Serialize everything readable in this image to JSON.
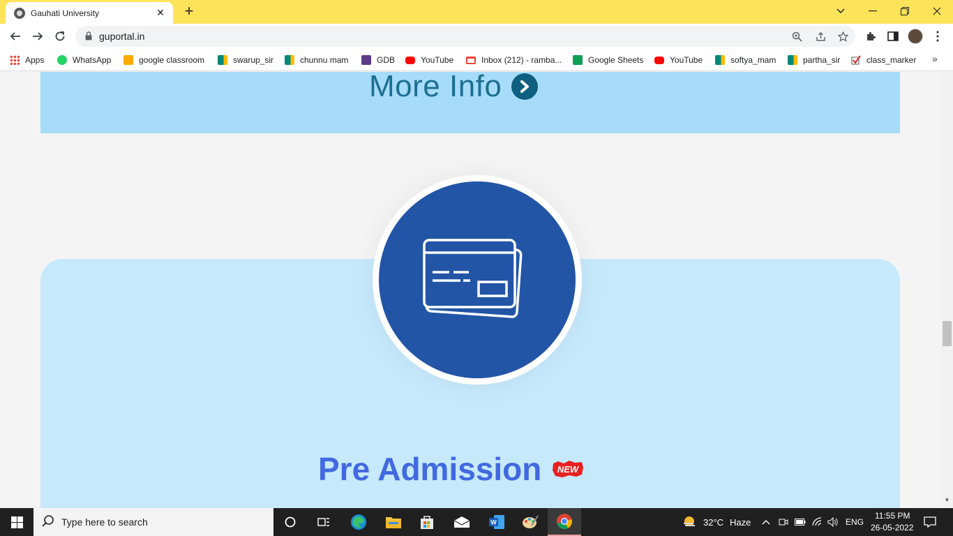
{
  "browser": {
    "tab_title": "Gauhati University",
    "tab_close": "✕",
    "new_tab": "+",
    "url": "guportal.in",
    "window_controls": {
      "minimize": "—",
      "maximize": "❐",
      "close": "✕",
      "tab_search": "⌄"
    }
  },
  "bookmarks": [
    {
      "label": "Apps",
      "icon": "apps-grid-icon"
    },
    {
      "label": "WhatsApp",
      "icon": "whatsapp-icon",
      "color": "#25d366"
    },
    {
      "label": "google classroom",
      "icon": "classroom-icon",
      "color": "#f9ab00"
    },
    {
      "label": "swarup_sir",
      "icon": "meet-icon",
      "color": "#00897b"
    },
    {
      "label": "chunnu mam",
      "icon": "meet-icon",
      "color": "#00897b"
    },
    {
      "label": "GDB",
      "icon": "gdb-icon",
      "color": "#5b3c88"
    },
    {
      "label": "YouTube",
      "icon": "youtube-icon",
      "color": "#ff0000"
    },
    {
      "label": "Inbox (212) - ramba...",
      "icon": "gmail-icon",
      "color": "#ea4335"
    },
    {
      "label": "Google Sheets",
      "icon": "sheets-icon",
      "color": "#0f9d58"
    },
    {
      "label": "YouTube",
      "icon": "youtube-icon",
      "color": "#ff0000"
    },
    {
      "label": "softya_mam",
      "icon": "meet-icon",
      "color": "#00897b"
    },
    {
      "label": "partha_sir",
      "icon": "meet-icon",
      "color": "#00897b"
    },
    {
      "label": "class_marker",
      "icon": "checkmark-icon",
      "color": "#d93025"
    }
  ],
  "bookmarks_more": "»",
  "page": {
    "more_info": "More Info",
    "card_title": "Pre Admission",
    "new_badge": "NEW",
    "colors": {
      "band": "#a6dcfa",
      "card": "#c6e9fb",
      "circle": "#2355a6",
      "title": "#4169e1"
    }
  },
  "taskbar": {
    "search_placeholder": "Type here to search",
    "weather": "32°C",
    "weather_desc": "Haze",
    "language": "ENG",
    "time": "11:55 PM",
    "date": "26-05-2022"
  }
}
